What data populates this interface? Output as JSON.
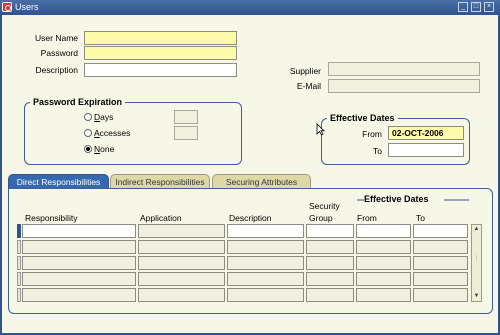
{
  "window": {
    "title": "Users",
    "icon": "oracle-app-icon"
  },
  "form": {
    "user_name_label": "User Name",
    "password_label": "Password",
    "description_label": "Description",
    "user_name_value": "",
    "password_value": "",
    "description_value": "",
    "supplier_label": "Supplier",
    "email_label": "E-Mail",
    "supplier_value": "",
    "email_value": ""
  },
  "password_expiration": {
    "title": "Password Expiration",
    "days_label": "Days",
    "accesses_label": "Accesses",
    "none_label": "None",
    "selected": "None",
    "days_value": "",
    "accesses_value": ""
  },
  "effective_dates": {
    "title": "Effective Dates",
    "from_label": "From",
    "to_label": "To",
    "from_value": "02-OCT-2006",
    "to_value": ""
  },
  "tabs": [
    {
      "label": "Direct Responsibilities",
      "active": true
    },
    {
      "label": "Indirect Responsibilities",
      "active": false
    },
    {
      "label": "Securing Attributes",
      "active": false
    }
  ],
  "table": {
    "effective_dates_header": "Effective Dates",
    "columns": {
      "responsibility": "Responsibility",
      "application": "Application",
      "description": "Description",
      "security_group_line1": "Security",
      "security_group_line2": "Group",
      "from": "From",
      "to": "To"
    },
    "rows": 5
  },
  "colors": {
    "title_bar": "#2f5490",
    "background": "#f7f7e7",
    "required_field": "#fdfba9",
    "active_tab": "#3668ad",
    "inactive_tab": "#ddd9a6",
    "group_border": "#3e5ea0"
  }
}
